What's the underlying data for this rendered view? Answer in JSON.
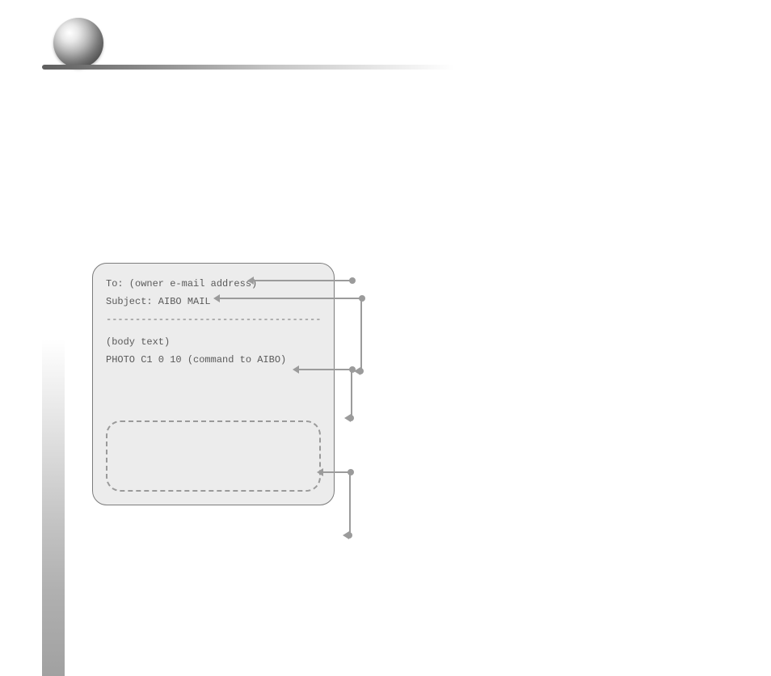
{
  "email_card": {
    "to_line": "To: (owner e-mail address)",
    "subject_line": "Subject: AIBO MAIL",
    "separator": "-------------------------------------",
    "body_label": "(body text)",
    "command_line": "PHOTO C1 0 10 (command to AIBO)"
  }
}
